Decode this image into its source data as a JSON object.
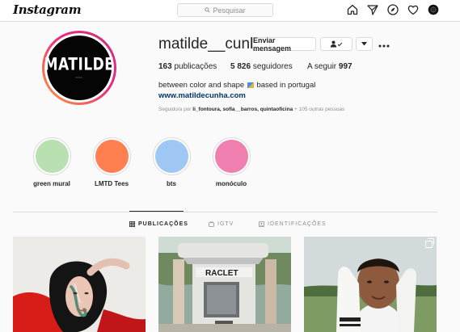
{
  "nav": {
    "logo": "Instagram",
    "search_placeholder": "Pesquisar",
    "icons": [
      "home-icon",
      "direct-icon",
      "explore-icon",
      "activity-icon",
      "profile-avatar-icon"
    ]
  },
  "profile": {
    "avatar_text": "MATILDE",
    "username": "matilde__cunha",
    "message_button": "Enviar mensagem",
    "stats": {
      "posts_count": "163",
      "posts_label": "publicações",
      "followers_count": "5 826",
      "followers_label": "seguidores",
      "following_label": "A seguir",
      "following_count": "997"
    },
    "bio_before": "between color and shape",
    "bio_after": "based in portugal",
    "website": "www.matildecunha.com",
    "followed_prefix": "Seguido/a por",
    "followed_names": "li_fontoura, sofia__barros, quintaoficina",
    "followed_suffix": "+ 105 outras pessoas"
  },
  "highlights": [
    {
      "label": "green mural",
      "color": "#b8e0b0"
    },
    {
      "label": "LMTD Tees",
      "color": "#ff7f50"
    },
    {
      "label": "bts",
      "color": "#9ec7f4"
    },
    {
      "label": "monóculo",
      "color": "#ef7fae"
    }
  ],
  "tabs": [
    {
      "label": "PUBLICAÇÕES",
      "icon": "grid-icon",
      "active": true
    },
    {
      "label": "IGTV",
      "icon": "igtv-icon",
      "active": false
    },
    {
      "label": "IDENTIFICAÇÕES",
      "icon": "tag-icon",
      "active": false
    }
  ],
  "posts": [
    {
      "kind": "portrait",
      "multiple": false
    },
    {
      "kind": "machine",
      "machine_text": "RACLET",
      "multiple": false
    },
    {
      "kind": "man-with-gloves",
      "multiple": true
    }
  ]
}
